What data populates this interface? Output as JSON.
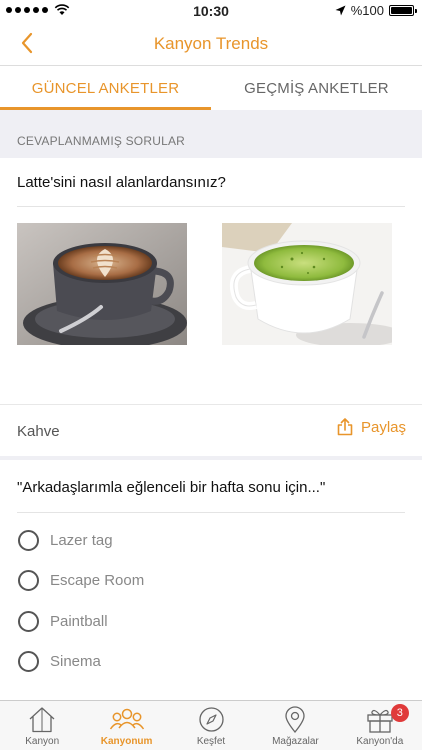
{
  "status_bar": {
    "time": "10:30",
    "battery": "%100",
    "battery_level": 1.0,
    "signal_icon": "signal-dots-icon",
    "wifi_icon": "wifi-icon",
    "location_icon": "location-arrow-icon"
  },
  "nav": {
    "title": "Kanyon Trends",
    "back_icon": "chevron-left-icon"
  },
  "tabs": [
    {
      "label": "GÜNCEL ANKETLER",
      "active": true
    },
    {
      "label": "GEÇMİŞ ANKETLER",
      "active": false
    }
  ],
  "section": {
    "header": "CEVAPLANMAMIŞ SORULAR"
  },
  "poll1": {
    "question": "Latte'sini nasıl alanlardansınız?",
    "options": [
      {
        "image": "latte-art-coffee-image"
      },
      {
        "image": "matcha-latte-image"
      }
    ],
    "category": "Kahve",
    "share_label": "Paylaş",
    "share_icon": "share-icon"
  },
  "poll2": {
    "question": "\"Arkadaşlarımla eğlenceli bir hafta sonu için...\"",
    "options": [
      "Lazer tag",
      "Escape Room",
      "Paintball",
      "Sinema"
    ]
  },
  "tab_bar": {
    "items": [
      {
        "label": "Kanyon",
        "icon": "home-icon"
      },
      {
        "label": "Kanyonum",
        "icon": "people-icon",
        "active": true
      },
      {
        "label": "Keşfet",
        "icon": "compass-icon"
      },
      {
        "label": "Mağazalar",
        "icon": "map-pin-icon"
      },
      {
        "label": "Kanyon'da",
        "icon": "gift-icon",
        "badge": "3"
      }
    ]
  },
  "colors": {
    "accent": "#e8952b",
    "badge": "#e03a3a"
  }
}
